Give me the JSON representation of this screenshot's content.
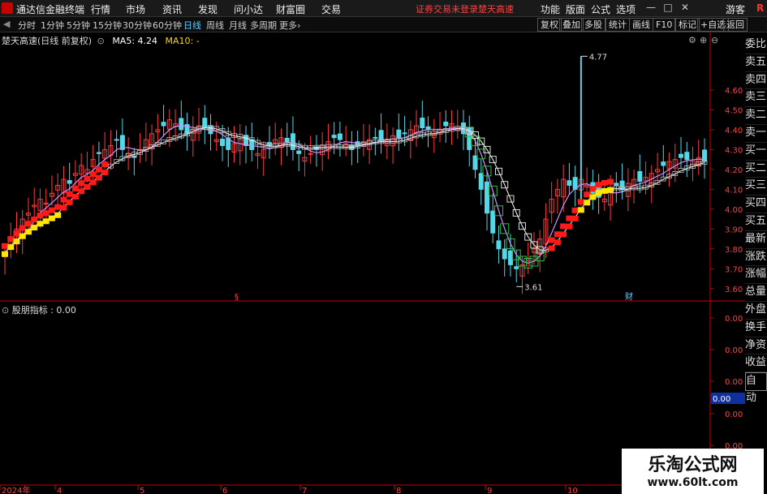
{
  "app": {
    "title": "通达信金融终端",
    "menu": [
      "行情",
      "市场",
      "资讯",
      "发现",
      "问小达",
      "财富圈",
      "交易"
    ],
    "warning": "证券交易未登录",
    "stock_label": "楚天高速",
    "right_menu": [
      "功能",
      "版面",
      "公式",
      "选项"
    ],
    "user": "游客",
    "win_buttons": [
      "—",
      "□",
      "✕"
    ]
  },
  "toolbar": {
    "periods": [
      "分时",
      "1分钟",
      "5分钟",
      "15分钟",
      "30分钟",
      "60分钟",
      "日线",
      "周线",
      "月线",
      "多周期",
      "更多›"
    ],
    "active": "日线",
    "right_buttons": [
      "复权",
      "叠加",
      "多股",
      "统计",
      "画线",
      "F10",
      "标记",
      "+自选",
      "返回"
    ]
  },
  "main_chart": {
    "title": "楚天高速(日线 前复权)",
    "ma5": "MA5: 4.24",
    "ma10": "MA10: -"
  },
  "sub_chart": {
    "title": "股朋指标 : 0.00",
    "axis": [
      "0.00",
      "0.00",
      "0.00",
      "0.00",
      "0.00"
    ],
    "highlight": "0.00"
  },
  "right_panel": [
    "委比",
    "卖五",
    "卖四",
    "卖三",
    "卖二",
    "卖一",
    "买一",
    "买二",
    "买三",
    "买四",
    "买五",
    "最新",
    "涨跌",
    "涨幅",
    "总量",
    "外盘",
    "换手",
    "净资",
    "收益",
    "自动"
  ],
  "chart_data": {
    "type": "candlestick",
    "ylim": [
      3.55,
      4.8
    ],
    "y_ticks": [
      "4.60",
      "4.50",
      "4.40",
      "4.30",
      "4.20",
      "4.10",
      "4.00",
      "3.90",
      "3.80",
      "3.70",
      "3.60"
    ],
    "x_ticks": [
      "2024年",
      "4",
      "5",
      "6",
      "7",
      "8",
      "9",
      "10"
    ],
    "annotations": {
      "high": "4.77",
      "low": "3.61",
      "marker1": "§",
      "marker2": "财"
    },
    "ma5_last": 4.24,
    "closes": [
      3.78,
      3.85,
      3.9,
      3.95,
      3.98,
      4.02,
      4.05,
      4.03,
      4.08,
      4.12,
      4.15,
      4.13,
      4.18,
      4.22,
      4.2,
      4.25,
      4.28,
      4.3,
      4.32,
      4.35,
      4.3,
      4.28,
      4.26,
      4.3,
      4.35,
      4.38,
      4.4,
      4.42,
      4.45,
      4.43,
      4.4,
      4.38,
      4.4,
      4.42,
      4.41,
      4.38,
      4.35,
      4.32,
      4.3,
      4.33,
      4.35,
      4.32,
      4.3,
      4.28,
      4.3,
      4.32,
      4.35,
      4.36,
      4.34,
      4.3,
      4.28,
      4.26,
      4.28,
      4.3,
      4.32,
      4.34,
      4.36,
      4.35,
      4.33,
      4.3,
      4.32,
      4.34,
      4.35,
      4.36,
      4.34,
      4.35,
      4.37,
      4.36,
      4.38,
      4.4,
      4.42,
      4.41,
      4.4,
      4.38,
      4.4,
      4.42,
      4.43,
      4.41,
      4.38,
      4.3,
      4.2,
      4.1,
      3.98,
      3.88,
      3.8,
      3.75,
      3.72,
      3.7,
      3.72,
      3.75,
      3.8,
      3.85,
      3.95,
      4.05,
      4.1,
      4.15,
      4.12,
      4.1,
      4.15,
      4.12,
      4.08,
      4.06,
      4.05,
      4.1,
      4.12,
      4.1,
      4.13,
      4.15,
      4.14,
      4.16,
      4.18,
      4.2,
      4.22,
      4.24,
      4.25,
      4.26,
      4.25,
      4.24,
      4.26,
      4.24
    ]
  }
}
